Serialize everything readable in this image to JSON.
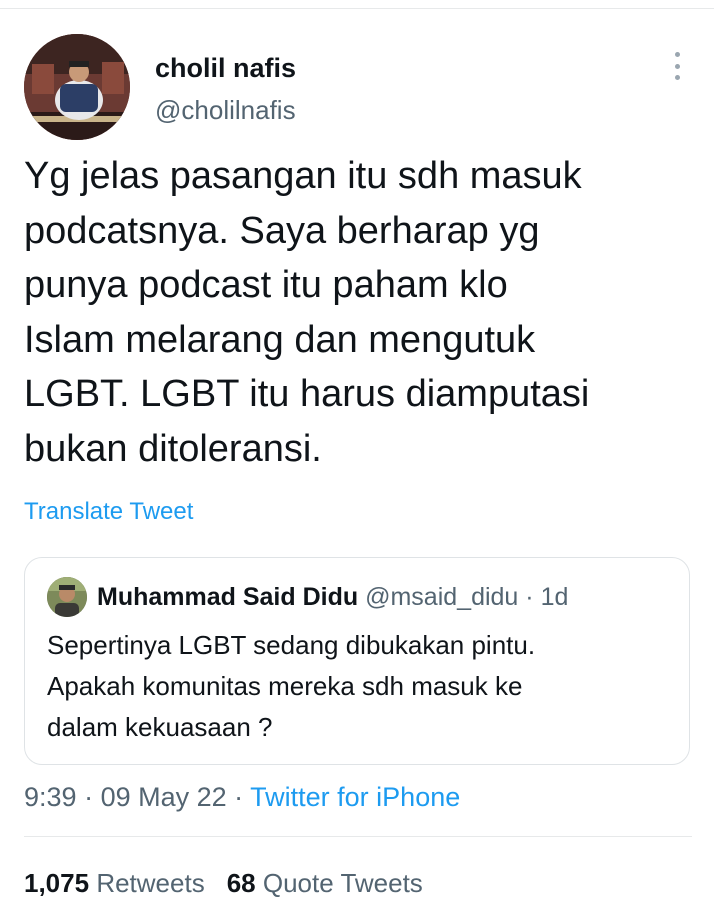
{
  "tweet": {
    "author_name": "cholil nafis",
    "author_handle": "@cholilnafis",
    "text_lines": [
      "Yg jelas pasangan itu sdh masuk",
      "podcatsnya. Saya berharap yg",
      "punya podcast itu paham klo",
      "Islam melarang dan mengutuk",
      "LGBT. LGBT itu harus diamputasi",
      "bukan ditoleransi."
    ],
    "translate_label": "Translate Tweet",
    "time": "9:39",
    "separator": " · ",
    "date": "09 May 22",
    "source": "Twitter for iPhone"
  },
  "quote": {
    "author_name": "Muhammad Said Didu",
    "author_handle": "@msaid_didu",
    "age": "1d",
    "text_lines": [
      "Sepertinya LGBT sedang dibukakan pintu.",
      "Apakah komunitas mereka sdh masuk ke",
      "dalam kekuasaan ?"
    ]
  },
  "stats": {
    "retweets_count": "1,075",
    "retweets_label": "Retweets",
    "quotes_count": "68",
    "quotes_label": "Quote Tweets"
  },
  "icons": {
    "more": "more-vertical-icon"
  },
  "colors": {
    "link": "#1d9bf0",
    "secondary_text": "#536471",
    "primary_text": "#0f1419",
    "divider": "#e7e9ea"
  }
}
